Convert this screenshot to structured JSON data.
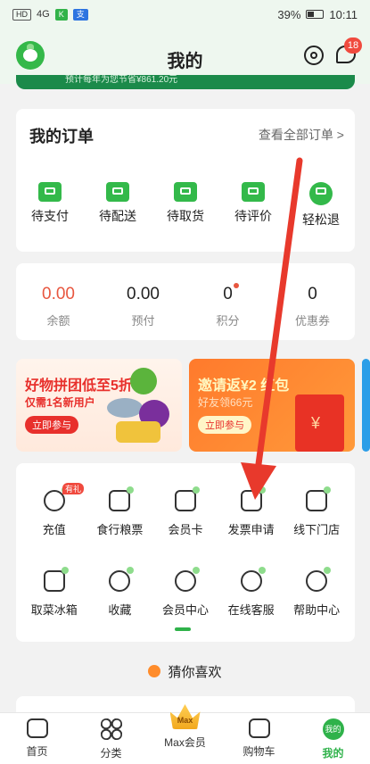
{
  "status_bar": {
    "left_items": [
      "HD",
      "4G",
      "K",
      "支"
    ],
    "battery": "39%",
    "time": "10:11"
  },
  "header": {
    "title": "我的",
    "message_badge": "18"
  },
  "promo_strip": {
    "text": "预计每年为您节省¥861.20元"
  },
  "orders": {
    "title": "我的订单",
    "view_all": "查看全部订单 >",
    "items": [
      {
        "label": "待支付",
        "icon": "wallet-icon"
      },
      {
        "label": "待配送",
        "icon": "delivery-truck-icon"
      },
      {
        "label": "待取货",
        "icon": "locker-icon"
      },
      {
        "label": "待评价",
        "icon": "comment-icon"
      },
      {
        "label": "轻松退",
        "icon": "refund-icon"
      }
    ]
  },
  "balance": {
    "items": [
      {
        "value": "0.00",
        "label": "余额"
      },
      {
        "value": "0.00",
        "label": "预付"
      },
      {
        "value": "0",
        "label": "积分"
      },
      {
        "value": "0",
        "label": "优惠券"
      }
    ]
  },
  "banners": [
    {
      "title": "好物拼团低至5折",
      "subtitle": "仅需1名新用户",
      "button": "立即参与"
    },
    {
      "title": "邀请返¥2 红包",
      "subtitle": "好友领66元",
      "button": "立即参与"
    }
  ],
  "services": {
    "row1": [
      {
        "label": "充值",
        "icon": "yuan-circle-icon",
        "tag": "有礼"
      },
      {
        "label": "食行粮票",
        "icon": "ticket-icon"
      },
      {
        "label": "会员卡",
        "icon": "vip-card-icon"
      },
      {
        "label": "发票申请",
        "icon": "invoice-icon"
      },
      {
        "label": "线下门店",
        "icon": "store-icon"
      }
    ],
    "row2": [
      {
        "label": "取菜冰箱",
        "icon": "fridge-icon"
      },
      {
        "label": "收藏",
        "icon": "star-icon"
      },
      {
        "label": "会员中心",
        "icon": "heart-badge-icon"
      },
      {
        "label": "在线客服",
        "icon": "headset-icon"
      },
      {
        "label": "帮助中心",
        "icon": "question-icon"
      }
    ]
  },
  "guess": {
    "title": "猜你喜欢"
  },
  "tabbar": {
    "items": [
      {
        "label": "首页",
        "icon": "home-icon"
      },
      {
        "label": "分类",
        "icon": "category-grid-icon"
      },
      {
        "label": "Max会员",
        "icon": "crown-icon",
        "icon_text": "Max"
      },
      {
        "label": "购物车",
        "icon": "cart-icon"
      },
      {
        "label": "我的",
        "icon": "profile-icon",
        "icon_text": "我的",
        "active": true
      }
    ]
  },
  "colors": {
    "brand_green": "#2fb24a",
    "accent_red": "#e8563f",
    "annotation_arrow": "#e8392c"
  }
}
